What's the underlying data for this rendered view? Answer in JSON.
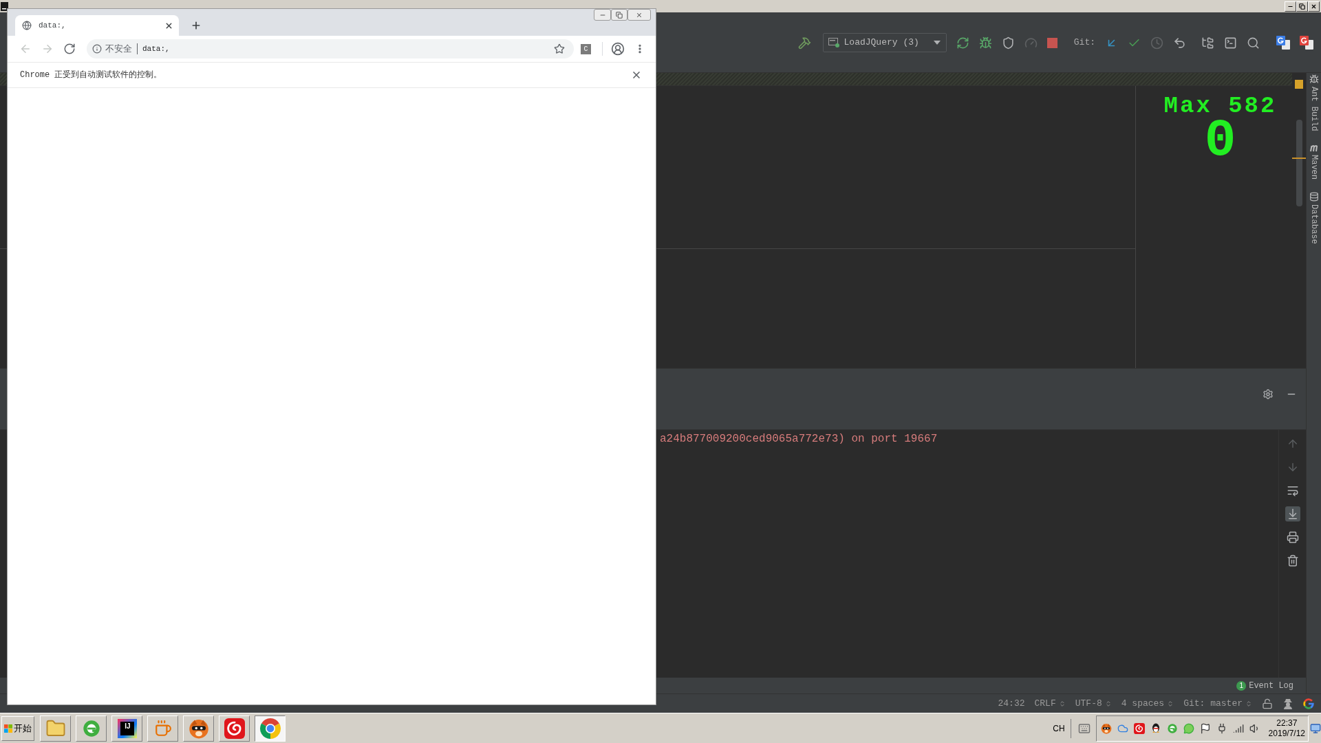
{
  "ide": {
    "toolbar": [
      {
        "kind": "build",
        "disabled": false
      },
      {
        "kind": "run-config",
        "label": "LoadJQuery (3)"
      },
      {
        "kind": "rerun",
        "disabled": false
      },
      {
        "kind": "debug",
        "disabled": false
      },
      {
        "kind": "coverage",
        "disabled": false
      },
      {
        "kind": "profile",
        "disabled": true
      },
      {
        "kind": "stop",
        "disabled": false
      },
      {
        "kind": "git-label",
        "label": "Git:"
      },
      {
        "kind": "update",
        "disabled": false
      },
      {
        "kind": "commit",
        "disabled": false
      },
      {
        "kind": "history",
        "disabled": true
      },
      {
        "kind": "revert",
        "disabled": false
      },
      {
        "kind": "project-structure",
        "disabled": false
      },
      {
        "kind": "run-window",
        "disabled": false
      },
      {
        "kind": "search",
        "disabled": false
      },
      {
        "kind": "translate",
        "disabled": false
      },
      {
        "kind": "translate-alt",
        "disabled": false
      }
    ],
    "overlay": {
      "title": "Max 582",
      "count": "0"
    },
    "tool_windows": [
      {
        "kind": "ant",
        "label": "Ant Build"
      },
      {
        "kind": "maven",
        "label": "Maven"
      },
      {
        "kind": "database",
        "label": "Database"
      }
    ],
    "console": {
      "lines": [
        "a24b877009200ced9065a772e73) on port 19667"
      ],
      "tools": [
        {
          "kind": "up",
          "disabled": true
        },
        {
          "kind": "down",
          "disabled": true
        },
        {
          "kind": "soft-wrap",
          "selected": false
        },
        {
          "kind": "scroll-end",
          "selected": true
        },
        {
          "kind": "print"
        },
        {
          "kind": "clear"
        }
      ]
    },
    "event_log": {
      "badge": "1",
      "label": "Event Log"
    },
    "status_bar": [
      {
        "label": "24:32",
        "dropdown": false
      },
      {
        "label": "CRLF",
        "dropdown": true
      },
      {
        "label": "UTF-8",
        "dropdown": true
      },
      {
        "label": "4 spaces",
        "dropdown": true
      },
      {
        "label": "Git: master",
        "dropdown": true
      }
    ]
  },
  "browser": {
    "tabs": [
      {
        "title": "data:,",
        "selected": true
      }
    ],
    "nav_buttons": [
      {
        "kind": "back",
        "disabled": true
      },
      {
        "kind": "forward",
        "disabled": true
      },
      {
        "kind": "reload",
        "disabled": false
      }
    ],
    "address_bar": {
      "security_label": "不安全",
      "url": "data:,"
    },
    "extension_badge": "C",
    "infobar": {
      "message": "Chrome 正受到自动测试软件的控制。"
    }
  },
  "taskbar": {
    "start_label": "开始",
    "apps": [
      {
        "kind": "explorer",
        "selected": false
      },
      {
        "kind": "browser-e",
        "selected": false
      },
      {
        "kind": "intellij",
        "selected": false,
        "logo_text": "IJ"
      },
      {
        "kind": "java",
        "selected": false
      },
      {
        "kind": "mascot",
        "selected": false
      },
      {
        "kind": "music",
        "selected": false
      },
      {
        "kind": "chrome",
        "selected": true
      }
    ],
    "language": "CH",
    "clock": {
      "time": "22:37",
      "date": "2019/7/12"
    }
  }
}
